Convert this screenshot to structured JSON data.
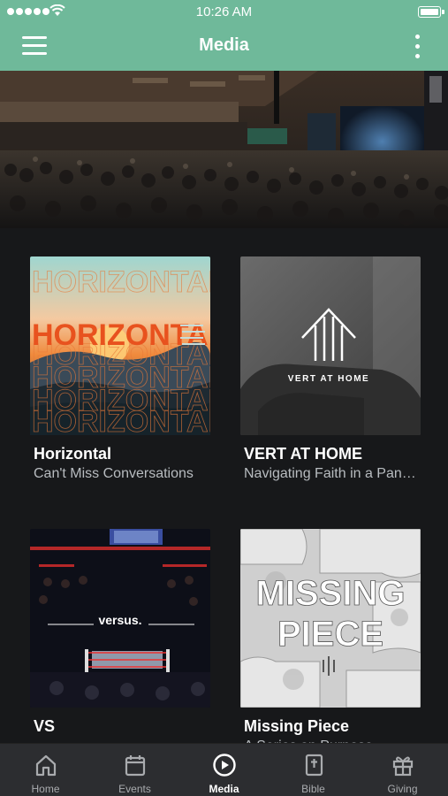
{
  "status_bar": {
    "time": "10:26 AM"
  },
  "header": {
    "title": "Media"
  },
  "hero": {
    "image": "church-auditorium-photo"
  },
  "series": [
    {
      "title": "Horizontal",
      "subtitle": "Can't Miss Conversations",
      "art_text": "HORIZONTAL"
    },
    {
      "title": "VERT AT HOME",
      "subtitle": "Navigating Faith in a Pandemic",
      "art_text": "VERT AT HOME"
    },
    {
      "title": "VS",
      "subtitle": "",
      "art_text": "versus."
    },
    {
      "title": "Missing Piece",
      "subtitle": "A Series on Purpose",
      "art_text_line1": "MISSING",
      "art_text_line2": "PIECE"
    }
  ],
  "tabs": [
    {
      "label": "Home",
      "icon": "home-icon"
    },
    {
      "label": "Events",
      "icon": "calendar-icon"
    },
    {
      "label": "Media",
      "icon": "play-circle-icon",
      "active": true
    },
    {
      "label": "Bible",
      "icon": "bible-icon"
    },
    {
      "label": "Giving",
      "icon": "gift-icon"
    }
  ],
  "colors": {
    "header": "#6fb99a",
    "background": "#17181a",
    "tab_bar": "#2c2d30"
  }
}
